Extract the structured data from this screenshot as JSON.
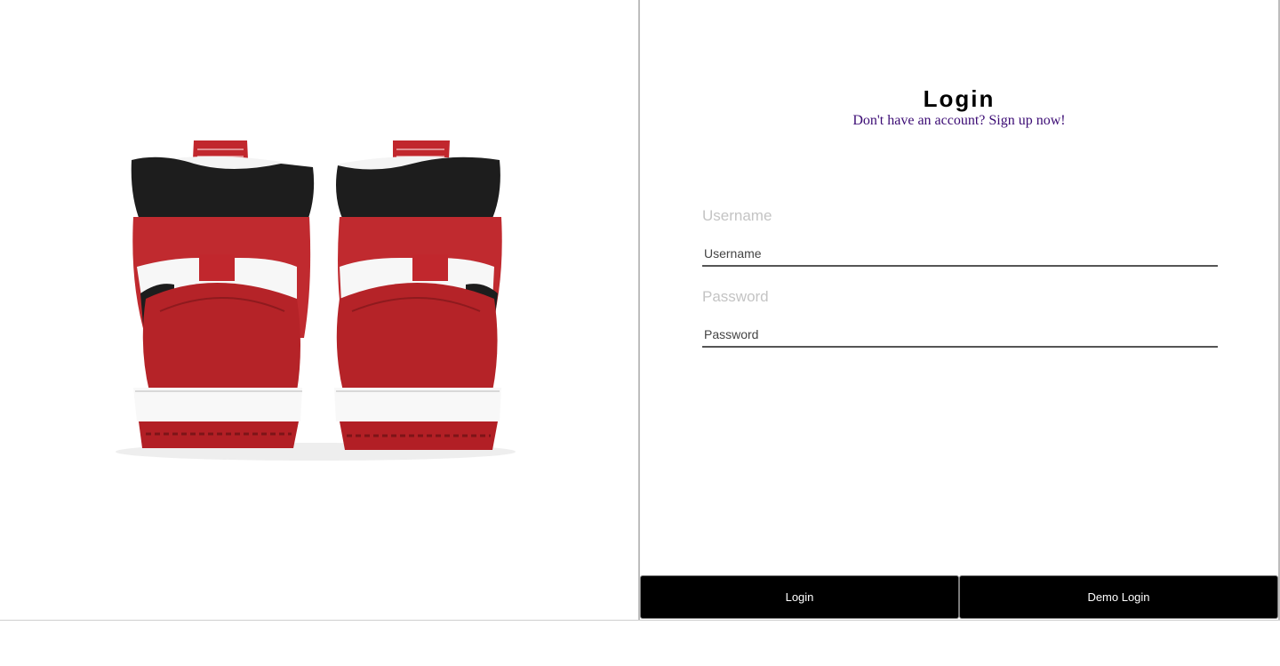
{
  "hero": {
    "image": "air-jordan-1-high-red-white-black-rear-view"
  },
  "login": {
    "title": "Login",
    "signup_link": "Don't have an account? Sign up now!",
    "username": {
      "label": "Username",
      "placeholder": "Username",
      "value": ""
    },
    "password": {
      "label": "Password",
      "placeholder": "Password",
      "value": ""
    },
    "login_button": "Login",
    "demo_button": "Demo Login"
  },
  "colors": {
    "button_bg": "#000000",
    "button_text": "#ffffff",
    "link": "#3b0b74",
    "label": "#c4c4c4",
    "shoe_red": "#c1272d",
    "shoe_black": "#1b1b1b"
  }
}
